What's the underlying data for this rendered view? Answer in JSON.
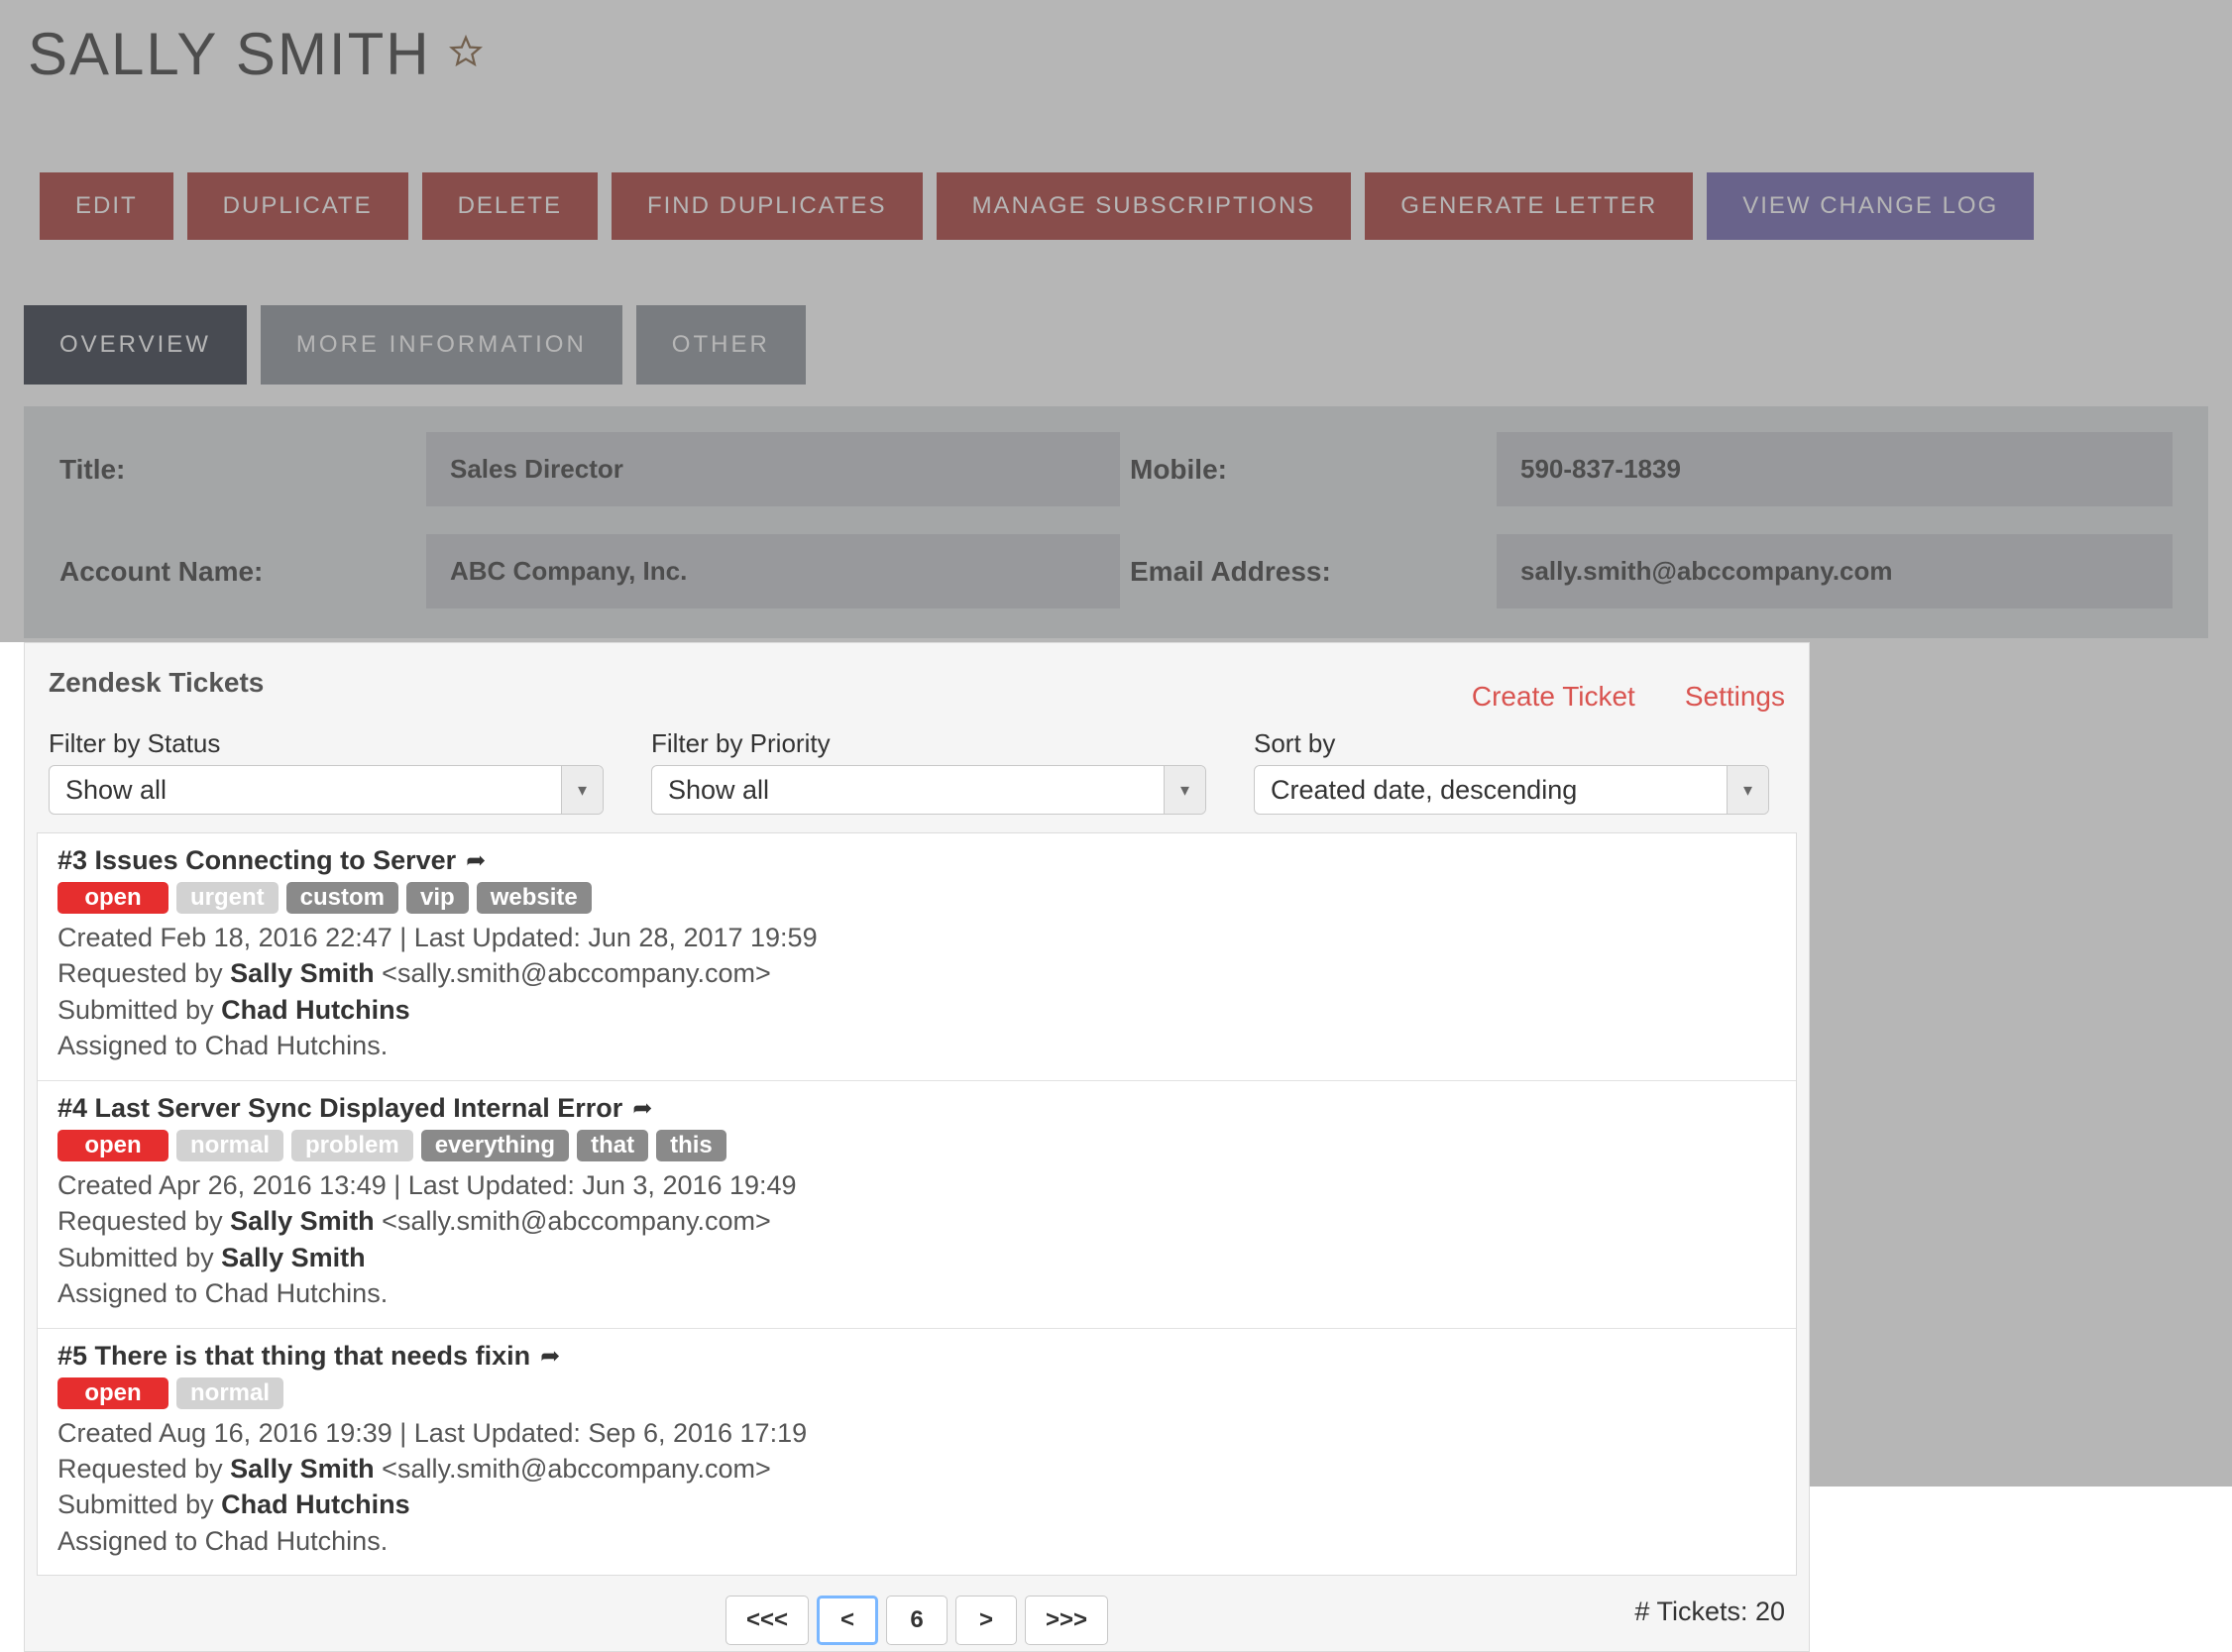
{
  "header": {
    "name": "SALLY SMITH"
  },
  "actions": {
    "edit": "EDIT",
    "duplicate": "DUPLICATE",
    "delete": "DELETE",
    "find_dupes": "FIND DUPLICATES",
    "manage_subs": "MANAGE SUBSCRIPTIONS",
    "gen_letter": "GENERATE LETTER",
    "change_log": "VIEW CHANGE LOG"
  },
  "tabs": {
    "overview": "OVERVIEW",
    "more": "MORE INFORMATION",
    "other": "OTHER"
  },
  "details": {
    "title_label": "Title:",
    "title_value": "Sales Director",
    "mobile_label": "Mobile:",
    "mobile_value": "590-837-1839",
    "account_label": "Account Name:",
    "account_value": "ABC Company, Inc.",
    "email_label": "Email Address:",
    "email_value": "sally.smith@abccompany.com"
  },
  "zendesk": {
    "title": "Zendesk Tickets",
    "create": "Create Ticket",
    "settings": "Settings",
    "filter_status_label": "Filter by Status",
    "filter_status_value": "Show all",
    "filter_priority_label": "Filter by Priority",
    "filter_priority_value": "Show all",
    "sort_label": "Sort by",
    "sort_value": "Created date, descending",
    "tickets": [
      {
        "title": "#3 Issues Connecting to Server",
        "status": "open",
        "priority": "urgent",
        "tags": [
          "custom",
          "vip",
          "website"
        ],
        "created_updated": "Created Feb 18, 2016 22:47 | Last Updated: Jun 28, 2017 19:59",
        "requested_prefix": "Requested by ",
        "requester": "Sally Smith",
        "requester_email": " <sally.smith@abccompany.com>",
        "submitted_prefix": "Submitted by ",
        "submitter": "Chad Hutchins",
        "assigned": "Assigned to Chad Hutchins."
      },
      {
        "title": "#4 Last Server Sync Displayed Internal Error",
        "status": "open",
        "priority": "normal",
        "extra_faded": "problem",
        "tags": [
          "everything",
          "that",
          "this"
        ],
        "created_updated": "Created Apr 26, 2016 13:49 | Last Updated: Jun 3, 2016 19:49",
        "requested_prefix": "Requested by ",
        "requester": "Sally Smith",
        "requester_email": " <sally.smith@abccompany.com>",
        "submitted_prefix": "Submitted by ",
        "submitter": "Sally Smith",
        "assigned": "Assigned to Chad Hutchins."
      },
      {
        "title": "#5 There is that thing that needs fixin",
        "status": "open",
        "priority": "normal",
        "tags": [],
        "created_updated": "Created Aug 16, 2016 19:39 | Last Updated: Sep 6, 2016 17:19",
        "requested_prefix": "Requested by ",
        "requester": "Sally Smith",
        "requester_email": " <sally.smith@abccompany.com>",
        "submitted_prefix": "Submitted by ",
        "submitter": "Chad Hutchins",
        "assigned": "Assigned to Chad Hutchins."
      }
    ],
    "pager": {
      "first": "<<<",
      "prev": "<",
      "current": "6",
      "next": ">",
      "last": ">>>"
    },
    "count": "# Tickets: 20"
  }
}
